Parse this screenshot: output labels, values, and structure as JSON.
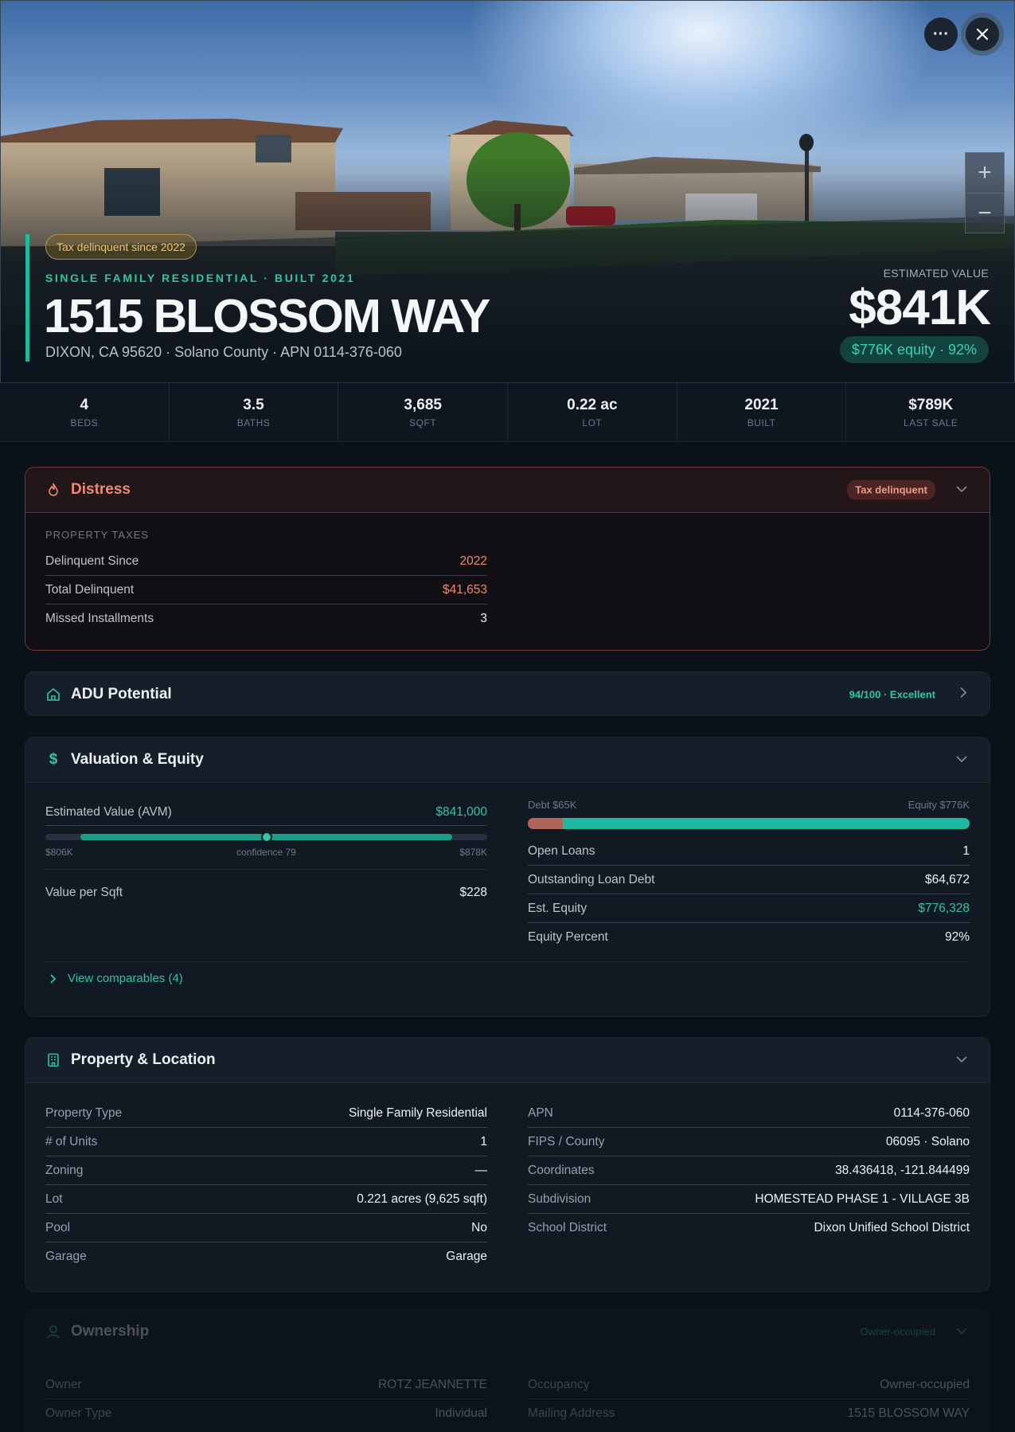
{
  "hero": {
    "tax_pill": "Tax delinquent since 2022",
    "subtitle": "SINGLE FAMILY RESIDENTIAL · BUILT 2021",
    "street": "1515 BLOSSOM WAY",
    "city_line": "DIXON, CA 95620 · Solano County · APN 0114-376-060",
    "estimated_label": "ESTIMATED VALUE",
    "estimated_value": "$841K",
    "equity_pill": "$776K equity · 92%",
    "more_icon": "more-horizontal-icon",
    "close_icon": "close-icon",
    "zoom_in": "+",
    "zoom_out": "−"
  },
  "stats": [
    {
      "value": "4",
      "label": "BEDS"
    },
    {
      "value": "3.5",
      "label": "BATHS"
    },
    {
      "value": "3,685",
      "label": "SQFT"
    },
    {
      "value": "0.22 ac",
      "label": "LOT"
    },
    {
      "value": "2021",
      "label": "BUILT"
    },
    {
      "value": "$789K",
      "label": "LAST SALE"
    }
  ],
  "distress": {
    "title": "Distress",
    "badge": "Tax delinquent",
    "section": "PROPERTY TAXES",
    "rows": [
      {
        "k": "Delinquent Since",
        "v": "2022"
      },
      {
        "k": "Total Delinquent",
        "v": "$41,653"
      },
      {
        "k": "Missed Installments",
        "v": "3"
      }
    ]
  },
  "adu": {
    "title": "ADU Potential",
    "score": "94/100 · Excellent"
  },
  "valuation": {
    "title": "Valuation & Equity",
    "avm_label": "Estimated Value (AVM)",
    "avm_value": "$841,000",
    "range_low": "$806K",
    "confidence": "confidence 79",
    "range_high": "$878K",
    "confidence_fraction": 0.79,
    "value_per_sqft_label": "Value per Sqft",
    "value_per_sqft": "$228",
    "debt_label": "Debt $65K",
    "equity_label": "Equity $776K",
    "debt_fraction": 0.08,
    "loans": [
      {
        "k": "Open Loans",
        "v": "1"
      },
      {
        "k": "Outstanding Loan Debt",
        "v": "$64,672"
      },
      {
        "k": "Est. Equity",
        "v": "$776,328"
      },
      {
        "k": "Equity Percent",
        "v": "92%"
      }
    ],
    "comparables_link": "View comparables (4)"
  },
  "property": {
    "title": "Property & Location",
    "left": [
      {
        "k": "Property Type",
        "v": "Single Family Residential"
      },
      {
        "k": "# of Units",
        "v": "1"
      },
      {
        "k": "Zoning",
        "v": "—"
      },
      {
        "k": "Lot",
        "v": "0.221 acres (9,625 sqft)"
      },
      {
        "k": "Pool",
        "v": "No"
      },
      {
        "k": "Garage",
        "v": "Garage"
      }
    ],
    "right": [
      {
        "k": "APN",
        "v": "0114-376-060"
      },
      {
        "k": "FIPS / County",
        "v": "06095 · Solano"
      },
      {
        "k": "Coordinates",
        "v": "38.436418, -121.844499"
      },
      {
        "k": "Subdivision",
        "v": "HOMESTEAD PHASE 1 - VILLAGE 3B"
      },
      {
        "k": "School District",
        "v": "Dixon Unified School District"
      }
    ]
  },
  "ownership": {
    "title": "Ownership",
    "tag": "Owner-occupied",
    "left": [
      {
        "k": "Owner",
        "v": "ROTZ JEANNETTE"
      },
      {
        "k": "Owner Type",
        "v": "Individual"
      }
    ],
    "right": [
      {
        "k": "Occupancy",
        "v": "Owner-occupied"
      },
      {
        "k": "Mailing Address",
        "v": "1515 BLOSSOM WAY"
      }
    ]
  },
  "colors": {
    "accent": "#2fc5aa",
    "distress": "#ef8a72",
    "background": "#0b1119",
    "tax_pill": "#e8c773"
  }
}
